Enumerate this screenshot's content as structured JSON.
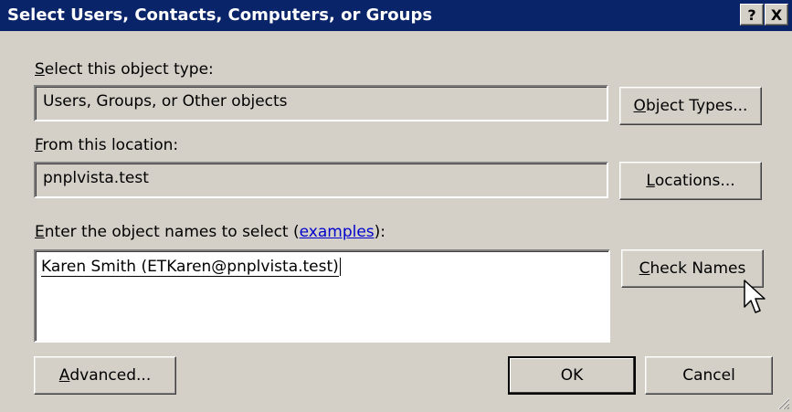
{
  "dialog": {
    "title": "Select Users, Contacts, Computers, or Groups",
    "help_button": "?",
    "close_button": "X"
  },
  "object_type": {
    "label_first": "S",
    "label_rest": "elect this object type:",
    "value": "Users, Groups, or Other objects",
    "button_first": "O",
    "button_rest": "bject Types..."
  },
  "location": {
    "label_first": "F",
    "label_rest": "rom this location:",
    "value": "pnplvista.test",
    "button_first": "L",
    "button_rest": "ocations..."
  },
  "names": {
    "label_first": "E",
    "label_rest": "nter the object names to select (",
    "link": "examples",
    "label_end": "):",
    "value": "Karen Smith (ETKaren@pnplvista.test)",
    "check_first": "C",
    "check_rest": "heck Names"
  },
  "footer": {
    "advanced_first": "A",
    "advanced_rest": "dvanced...",
    "ok": "OK",
    "cancel": "Cancel"
  },
  "icons": {
    "cursor": "mouse-pointer-icon",
    "grip": "resize-grip-icon"
  }
}
